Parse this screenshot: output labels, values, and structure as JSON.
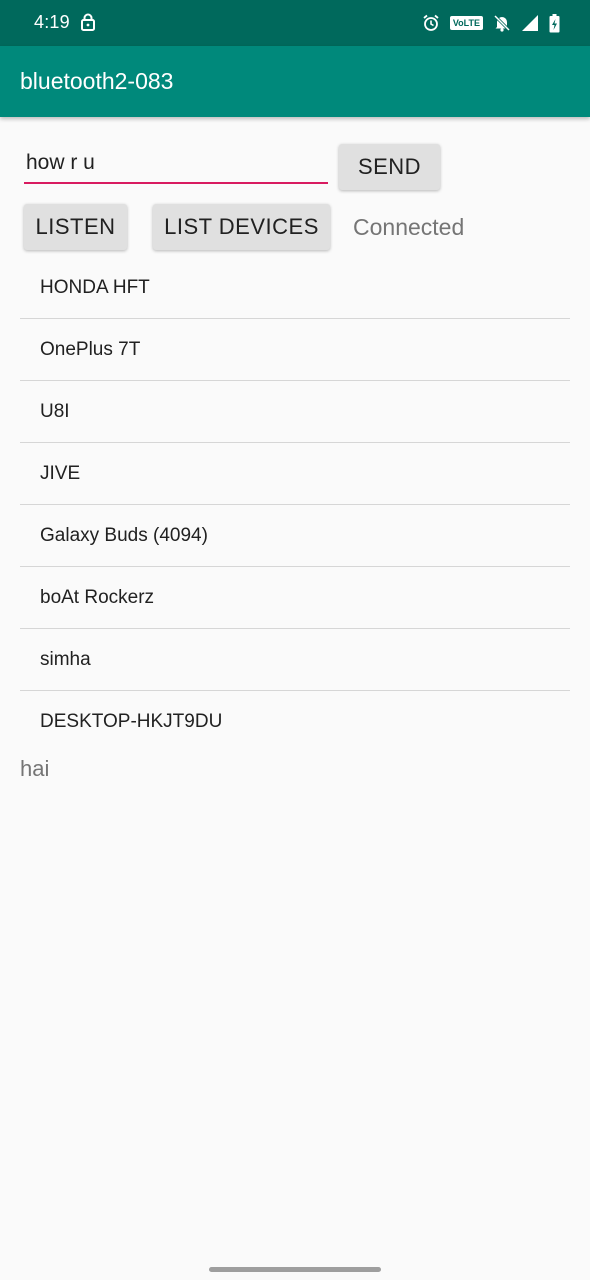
{
  "status_bar": {
    "time": "4:19",
    "volte_badge": "VoLTE",
    "icons": [
      "lock-icon",
      "alarm-icon",
      "volte-icon",
      "notifications-off-icon",
      "signal-icon",
      "battery-charging-icon"
    ]
  },
  "app_bar": {
    "title": "bluetooth2-083",
    "color": "#00897b",
    "status_color": "#00695c"
  },
  "compose": {
    "message_value": "how r u",
    "send_label": "SEND",
    "underline_color": "#d81b60"
  },
  "controls": {
    "listen_label": "LISTEN",
    "list_devices_label": "LIST DEVICES",
    "connection_status": "Connected"
  },
  "devices": [
    "HONDA HFT",
    "OnePlus 7T",
    "U8I",
    "JIVE",
    "Galaxy Buds (4094)",
    "boAt Rockerz",
    "simha",
    "DESKTOP-HKJT9DU"
  ],
  "received_message": "hai"
}
